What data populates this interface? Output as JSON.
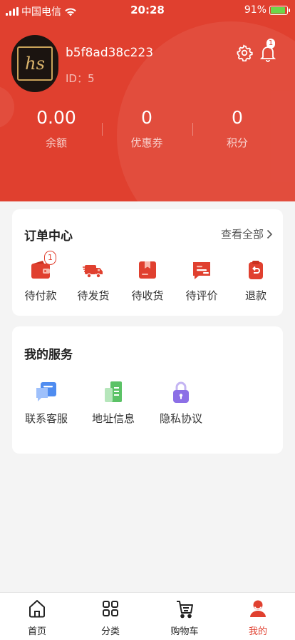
{
  "status_bar": {
    "carrier": "中国电信",
    "time": "20:28",
    "battery": "91%",
    "battery_level": 0.91
  },
  "profile": {
    "username": "b5f8ad38c223",
    "user_id": "ID：5",
    "avatar_text": "hs",
    "notification_count": "1"
  },
  "stats": [
    {
      "value": "0.00",
      "label": "余额"
    },
    {
      "value": "0",
      "label": "优惠券"
    },
    {
      "value": "0",
      "label": "积分"
    }
  ],
  "orders": {
    "title": "订单中心",
    "view_all": "查看全部",
    "items": [
      {
        "label": "待付款",
        "icon": "wallet-icon",
        "badge": "1"
      },
      {
        "label": "待发货",
        "icon": "truck-icon"
      },
      {
        "label": "待收货",
        "icon": "package-icon"
      },
      {
        "label": "待评价",
        "icon": "review-icon"
      },
      {
        "label": "退款",
        "icon": "refund-icon"
      }
    ]
  },
  "services": {
    "title": "我的服务",
    "items": [
      {
        "label": "联系客服",
        "icon": "chat-icon"
      },
      {
        "label": "地址信息",
        "icon": "address-icon"
      },
      {
        "label": "隐私协议",
        "icon": "lock-icon"
      }
    ]
  },
  "tabs": [
    {
      "label": "首页",
      "icon": "home-icon"
    },
    {
      "label": "分类",
      "icon": "grid-icon"
    },
    {
      "label": "购物车",
      "icon": "cart-icon"
    },
    {
      "label": "我的",
      "icon": "user-icon",
      "active": true
    }
  ],
  "colors": {
    "brand": "#e0402f",
    "battery": "#6bd54a"
  }
}
